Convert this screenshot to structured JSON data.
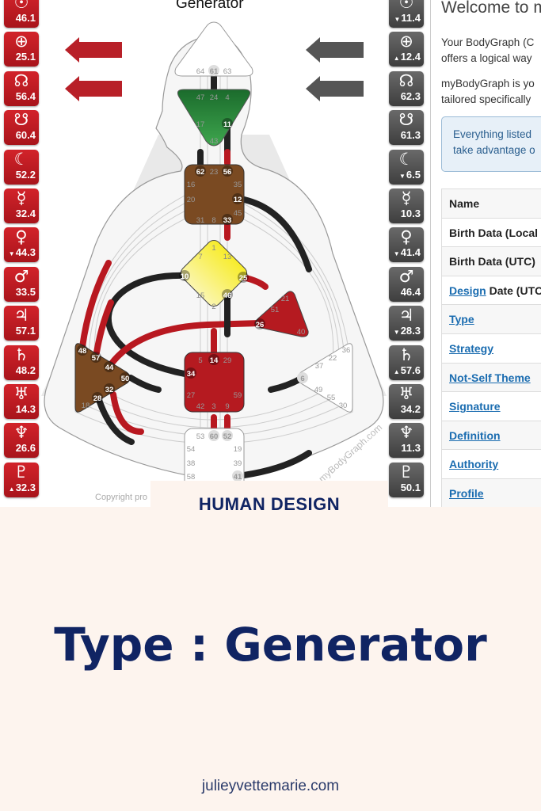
{
  "chart_title": "Generator",
  "design_planets": [
    {
      "icon": "sun-icon",
      "symbol": "☉",
      "value": "46.1",
      "arrow": ""
    },
    {
      "icon": "earth-icon",
      "symbol": "⊕",
      "value": "25.1",
      "arrow": ""
    },
    {
      "icon": "north-node-icon",
      "symbol": "☊",
      "value": "56.4",
      "arrow": ""
    },
    {
      "icon": "south-node-icon",
      "symbol": "☋",
      "value": "60.4",
      "arrow": ""
    },
    {
      "icon": "moon-icon",
      "symbol": "☾",
      "value": "52.2",
      "arrow": ""
    },
    {
      "icon": "mercury-icon",
      "symbol": "☿",
      "value": "32.4",
      "arrow": ""
    },
    {
      "icon": "venus-icon",
      "symbol": "♀",
      "value": "44.3",
      "arrow": "▼"
    },
    {
      "icon": "mars-icon",
      "symbol": "♂",
      "value": "33.5",
      "arrow": ""
    },
    {
      "icon": "jupiter-icon",
      "symbol": "♃",
      "value": "57.1",
      "arrow": ""
    },
    {
      "icon": "saturn-icon",
      "symbol": "♄",
      "value": "48.2",
      "arrow": ""
    },
    {
      "icon": "uranus-icon",
      "symbol": "♅",
      "value": "14.3",
      "arrow": ""
    },
    {
      "icon": "neptune-icon",
      "symbol": "♆",
      "value": "26.6",
      "arrow": ""
    },
    {
      "icon": "pluto-icon",
      "symbol": "♇",
      "value": "32.3",
      "arrow": "▲"
    }
  ],
  "personality_planets": [
    {
      "icon": "sun-icon",
      "symbol": "☉",
      "value": "11.4",
      "arrow": "▼"
    },
    {
      "icon": "earth-icon",
      "symbol": "⊕",
      "value": "12.4",
      "arrow": "▲"
    },
    {
      "icon": "north-node-icon",
      "symbol": "☊",
      "value": "62.3",
      "arrow": ""
    },
    {
      "icon": "south-node-icon",
      "symbol": "☋",
      "value": "61.3",
      "arrow": ""
    },
    {
      "icon": "moon-icon",
      "symbol": "☾",
      "value": "6.5",
      "arrow": "▼"
    },
    {
      "icon": "mercury-icon",
      "symbol": "☿",
      "value": "10.3",
      "arrow": ""
    },
    {
      "icon": "venus-icon",
      "symbol": "♀",
      "value": "41.4",
      "arrow": "▼"
    },
    {
      "icon": "mars-icon",
      "symbol": "♂",
      "value": "46.4",
      "arrow": ""
    },
    {
      "icon": "jupiter-icon",
      "symbol": "♃",
      "value": "28.3",
      "arrow": "▼"
    },
    {
      "icon": "saturn-icon",
      "symbol": "♄",
      "value": "57.6",
      "arrow": "▲"
    },
    {
      "icon": "uranus-icon",
      "symbol": "♅",
      "value": "34.2",
      "arrow": ""
    },
    {
      "icon": "neptune-icon",
      "symbol": "♆",
      "value": "11.3",
      "arrow": ""
    },
    {
      "icon": "pluto-icon",
      "symbol": "♇",
      "value": "50.1",
      "arrow": ""
    }
  ],
  "colors": {
    "design": "#b81820",
    "personality": "#4a4a4a",
    "throat": "#7a4a22",
    "ajna": "#2e8b3e",
    "g": "#f4ea40",
    "sacral": "#b51a20",
    "navy": "#102463"
  },
  "gates": {
    "head": [
      "64",
      "61",
      "63"
    ],
    "ajna": [
      "47",
      "24",
      "4",
      "17",
      "11",
      "43"
    ],
    "throat": [
      "62",
      "23",
      "56",
      "16",
      "35",
      "20",
      "12",
      "45",
      "31",
      "8",
      "33"
    ],
    "g": [
      "7",
      "1",
      "13",
      "10",
      "25",
      "15",
      "46",
      "2"
    ],
    "heart": [
      "21",
      "51",
      "26",
      "40"
    ],
    "spleen": [
      "48",
      "57",
      "44",
      "50",
      "32",
      "28",
      "18"
    ],
    "sacral": [
      "5",
      "14",
      "29",
      "34",
      "27",
      "59",
      "42",
      "3",
      "9"
    ],
    "solar_plexus": [
      "36",
      "22",
      "37",
      "6",
      "49",
      "55",
      "30"
    ],
    "root": [
      "53",
      "60",
      "52",
      "54",
      "19",
      "38",
      "39",
      "58",
      "41"
    ]
  },
  "watermark": "myBodyGraph.com",
  "copyright": "Copyright pro",
  "panel": {
    "welcome": "Welcome to m",
    "para1_line1": "Your BodyGraph (C",
    "para1_line2": "offers a logical way",
    "para2_line1": "myBodyGraph is yo",
    "para2_line2": "tailored specifically",
    "info_line1": "Everything listed",
    "info_line2": "take advantage o",
    "rows": [
      {
        "link": "",
        "label": "Name"
      },
      {
        "link": "",
        "label": "Birth Data (Local"
      },
      {
        "link": "",
        "label": "Birth Data (UTC)"
      },
      {
        "link": "Design",
        "label": " Date (UTC"
      },
      {
        "link": "Type",
        "label": ""
      },
      {
        "link": "Strategy",
        "label": ""
      },
      {
        "link": "Not-Self Theme",
        "label": ""
      },
      {
        "link": "Signature",
        "label": ""
      },
      {
        "link": "Definition",
        "label": ""
      },
      {
        "link": "Authority",
        "label": ""
      },
      {
        "link": "Profile",
        "label": ""
      }
    ]
  },
  "banner": "HUMAN DESIGN",
  "headline": "Type : Generator",
  "website": "julieyvettemarie.com"
}
